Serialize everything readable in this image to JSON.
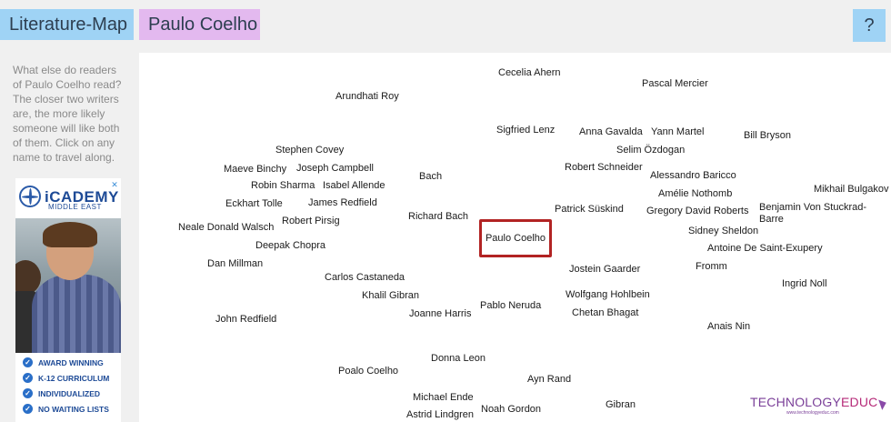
{
  "header": {
    "site_title": "Literature-Map",
    "current_author": "Paulo Coelho",
    "help_label": "?"
  },
  "sidebar": {
    "description": "What else do readers of Paulo Coelho read? The closer two writers are, the more likely someone will like both of them. Click on any name to travel along."
  },
  "ad": {
    "brand": "iCADEMY",
    "sub": "MIDDLE EAST",
    "close_label": "✕",
    "items": [
      "AWARD WINNING",
      "K-12 CURRICULUM",
      "INDIVIDUALIZED",
      "NO WAITING LISTS"
    ]
  },
  "map": {
    "center_author": "Paulo Coelho",
    "authors": [
      "Cecelia Ahern",
      "Pascal Mercier",
      "Arundhati Roy",
      "Sigfried Lenz",
      "Anna Gavalda",
      "Yann Martel",
      "Bill Bryson",
      "Selim Özdogan",
      "Stephen Covey",
      "Maeve Binchy",
      "Joseph Campbell",
      "Robert Schneider",
      "Alessandro Baricco",
      "Bach",
      "Robin Sharma",
      "Isabel Allende",
      "Amélie Nothomb",
      "Mikhail Bulgakov",
      "Eckhart Tolle",
      "James Redfield",
      "Patrick Süskind",
      "Gregory David Roberts",
      "Benjamin Von Stuckrad-Barre",
      "Richard Bach",
      "Robert Pirsig",
      "Neale Donald Walsch",
      "Sidney Sheldon",
      "Deepak Chopra",
      "Antoine De Saint-Exupery",
      "Dan Millman",
      "Fromm",
      "Jostein Gaarder",
      "Carlos Castaneda",
      "Ingrid Noll",
      "Khalil Gibran",
      "Wolfgang Hohlbein",
      "Pablo Neruda",
      "Joanne Harris",
      "Chetan Bhagat",
      "John Redfield",
      "Anais Nin",
      "Donna Leon",
      "Poalo Coelho",
      "Ayn Rand",
      "Michael Ende",
      "Noah Gordon",
      "Gibran",
      "Astrid Lindgren"
    ]
  },
  "watermark": {
    "text_main": "TECHNOLOGY",
    "text_highlight": "EDUC",
    "sub": "www.technologyeduc.com",
    "accent": "#7a3f98"
  }
}
